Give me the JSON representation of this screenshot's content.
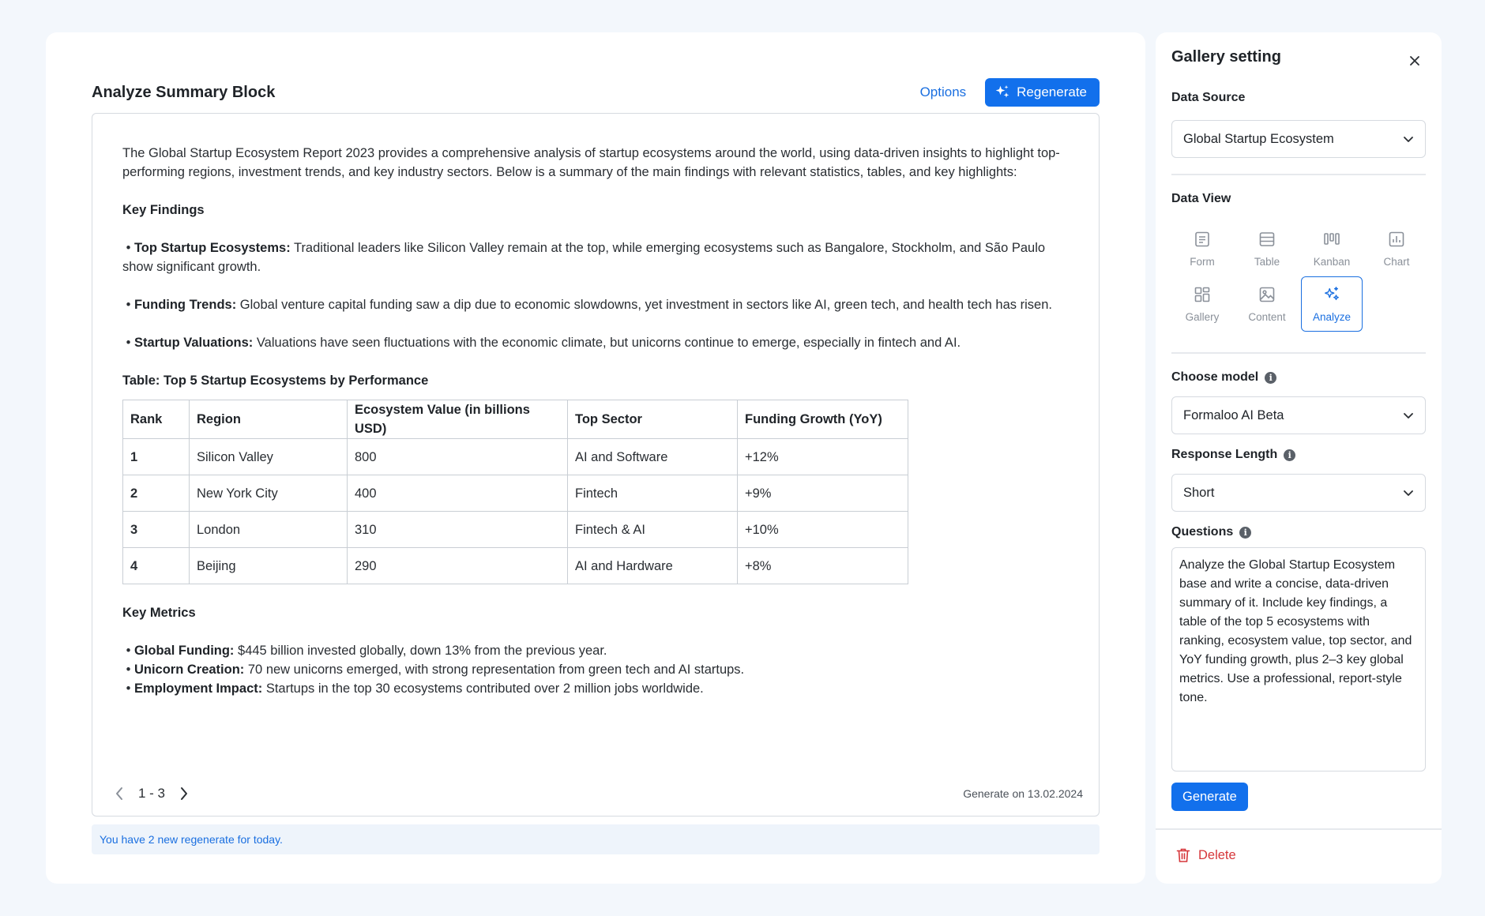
{
  "block": {
    "title": "Analyze Summary Block",
    "options_label": "Options",
    "regenerate_label": "Regenerate"
  },
  "summary": {
    "intro": "The Global Startup Ecosystem Report 2023 provides a comprehensive analysis of startup ecosystems around the world, using data-driven insights to highlight top-performing regions, investment trends, and key industry sectors. Below is a summary of the main findings with relevant statistics, tables, and key highlights:",
    "key_findings_title": "Key Findings",
    "findings": [
      {
        "bold": "Top Startup Ecosystems:",
        "text": " Traditional leaders like Silicon Valley remain at the top, while emerging ecosystems such as Bangalore, Stockholm, and São Paulo show significant growth."
      },
      {
        "bold": "Funding Trends:",
        "text": " Global venture capital funding saw a dip due to economic slowdowns, yet investment in sectors like AI, green tech, and health tech has risen."
      },
      {
        "bold": "Startup Valuations:",
        "text": " Valuations have seen fluctuations with the economic climate, but unicorns continue to emerge, especially in fintech and AI."
      }
    ],
    "table_title": "Table: Top 5 Startup Ecosystems by Performance",
    "table_headers": [
      "Rank",
      "Region",
      "Ecosystem Value (in billions USD)",
      "Top Sector",
      "Funding Growth (YoY)"
    ],
    "table_rows": [
      [
        "1",
        "Silicon Valley",
        "800",
        "AI and Software",
        "+12%"
      ],
      [
        "2",
        "New York City",
        "400",
        "Fintech",
        "+9%"
      ],
      [
        "3",
        "London",
        "310",
        "Fintech & AI",
        "+10%"
      ],
      [
        "4",
        "Beijing",
        "290",
        "AI and Hardware",
        "+8%"
      ]
    ],
    "key_metrics_title": "Key Metrics",
    "metrics": [
      {
        "bold": "Global Funding:",
        "text": " $445 billion invested globally, down 13% from the previous year."
      },
      {
        "bold": "Unicorn Creation:",
        "text": " 70 new unicorns emerged, with strong representation from green tech and AI startups."
      },
      {
        "bold": "Employment Impact:",
        "text": " Startups in the top 30 ecosystems contributed over 2 million jobs worldwide."
      }
    ]
  },
  "pager": {
    "range": "1 - 3"
  },
  "generated_on": "Generate on 13.02.2024",
  "notice": "You have 2 new regenerate for today.",
  "panel": {
    "title": "Gallery setting",
    "data_source_label": "Data Source",
    "data_source_value": "Global Startup Ecosystem",
    "data_view_label": "Data View",
    "views": [
      {
        "label": "Form",
        "icon": "form-icon",
        "active": false
      },
      {
        "label": "Table",
        "icon": "table-icon",
        "active": false
      },
      {
        "label": "Kanban",
        "icon": "kanban-icon",
        "active": false
      },
      {
        "label": "Chart",
        "icon": "chart-icon",
        "active": false
      },
      {
        "label": "Gallery",
        "icon": "gallery-icon",
        "active": false
      },
      {
        "label": "Content",
        "icon": "image-icon",
        "active": false
      },
      {
        "label": "Analyze",
        "icon": "sparkles-icon",
        "active": true
      }
    ],
    "model_label": "Choose model",
    "model_value": "Formaloo AI Beta",
    "length_label": "Response Length",
    "length_value": "Short",
    "questions_label": "Questions",
    "questions_value": "Analyze the Global Startup Ecosystem base and write a concise, data-driven summary of it. Include key findings, a table of the top 5 ecosystems with ranking, ecosystem value, top sector, and YoY funding growth, plus 2–3 key global metrics. Use a professional, report-style tone.",
    "generate_label": "Generate",
    "delete_label": "Delete"
  },
  "colors": {
    "accent": "#1270ec",
    "danger": "#d6363a",
    "background": "#f3f7fc",
    "notice_bg": "#eef4fb"
  }
}
